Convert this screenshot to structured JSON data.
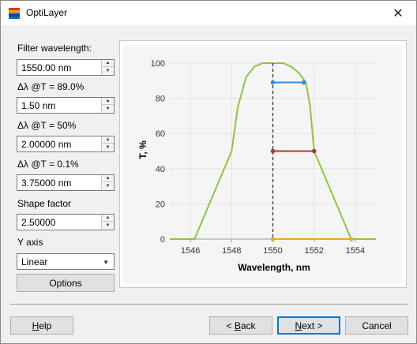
{
  "window": {
    "title": "OptiLayer",
    "close_glyph": "✕"
  },
  "form": {
    "filter_wavelength": {
      "label": "Filter wavelength:",
      "value": "1550.00 nm"
    },
    "dl_89": {
      "label": "Δλ @T = 89.0%",
      "value": "1.50 nm"
    },
    "dl_50": {
      "label": "Δλ @T = 50%",
      "value": "2.00000 nm"
    },
    "dl_01": {
      "label": "Δλ @T = 0.1%",
      "value": "3.75000 nm"
    },
    "shape_factor": {
      "label": "Shape factor",
      "value": "2.50000"
    },
    "y_axis": {
      "label": "Y axis",
      "selected": "Linear"
    },
    "options_label": "Options",
    "spin_up_glyph": "▲",
    "spin_down_glyph": "▼",
    "combo_glyph": "▼"
  },
  "buttons": {
    "help": {
      "access": "H",
      "rest": "elp"
    },
    "back": {
      "pre": "< ",
      "access": "B",
      "rest": "ack"
    },
    "next": {
      "access": "N",
      "rest": "ext >"
    },
    "cancel": "Cancel"
  },
  "icons": {
    "app": "optilayer-app-icon",
    "close": "close-icon"
  },
  "chart_data": {
    "type": "line",
    "xlabel": "Wavelength, nm",
    "ylabel": "T, %",
    "xlim": [
      1545,
      1555
    ],
    "ylim": [
      0,
      100
    ],
    "xticks": [
      1546,
      1548,
      1550,
      1552,
      1554
    ],
    "yticks": [
      0,
      20,
      40,
      60,
      80,
      100
    ],
    "grid": true,
    "series": [
      {
        "color": "#8dc63f",
        "x": [
          1545.0,
          1546.2,
          1548.0,
          1548.3,
          1548.7,
          1549.1,
          1549.5,
          1550.0,
          1550.5,
          1550.9,
          1551.3,
          1551.6,
          1551.8,
          1552.0,
          1553.8,
          1555.0
        ],
        "y": [
          0,
          0,
          50,
          75,
          92,
          98,
          100,
          100,
          100,
          98,
          94,
          89,
          76,
          50,
          0,
          0
        ]
      }
    ],
    "markers": [
      {
        "color": "#2f8fd8",
        "x": [
          1550.0,
          1551.5
        ],
        "y": [
          89,
          89
        ]
      },
      {
        "color": "#b03a2e",
        "x": [
          1550.0,
          1552.0
        ],
        "y": [
          50,
          50
        ]
      },
      {
        "color": "#f5a623",
        "x": [
          1550.0,
          1553.8
        ],
        "y": [
          0,
          0
        ]
      }
    ],
    "center_line": {
      "x": 1550,
      "color": "#333333"
    }
  }
}
